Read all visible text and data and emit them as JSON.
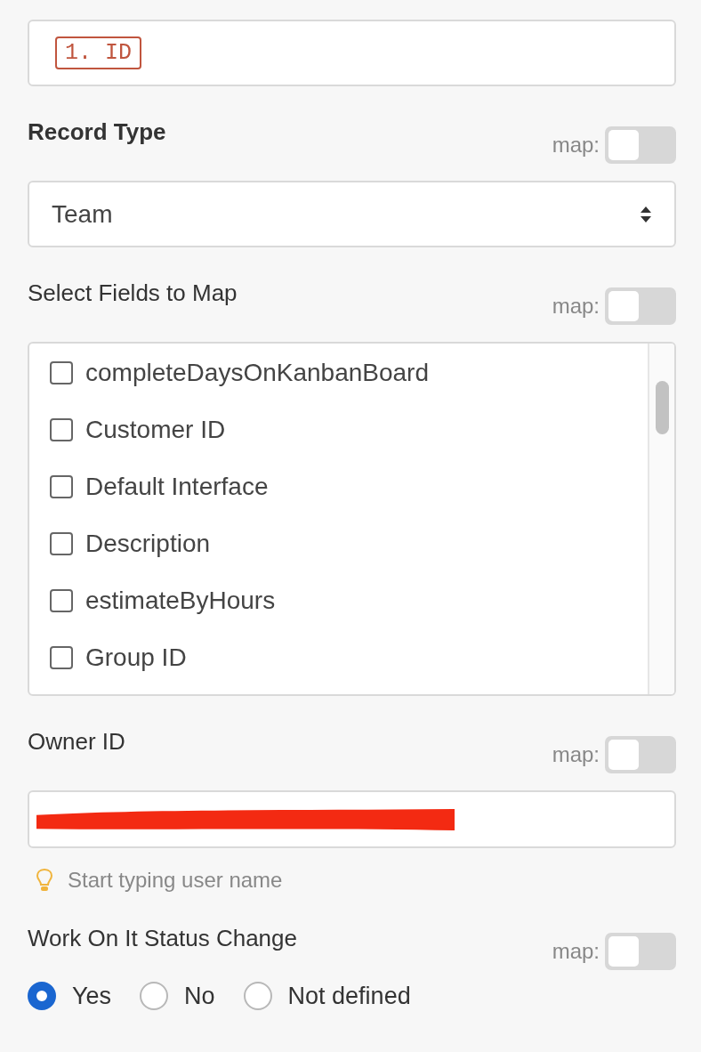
{
  "id_field": {
    "token": "1. ID"
  },
  "record_type": {
    "label": "Record Type",
    "map_label": "map:",
    "map_on": false,
    "value": "Team"
  },
  "fields_to_map": {
    "label": "Select Fields to Map",
    "map_label": "map:",
    "map_on": false,
    "options": [
      {
        "label": "completeDaysOnKanbanBoard",
        "checked": false
      },
      {
        "label": "Customer ID",
        "checked": false
      },
      {
        "label": "Default Interface",
        "checked": false
      },
      {
        "label": "Description",
        "checked": false
      },
      {
        "label": "estimateByHours",
        "checked": false
      },
      {
        "label": "Group ID",
        "checked": false
      }
    ]
  },
  "owner_id": {
    "label": "Owner ID",
    "map_label": "map:",
    "map_on": false,
    "redacted": true,
    "hint": "Start typing user name"
  },
  "status_change": {
    "label": "Work On It Status Change",
    "map_label": "map:",
    "map_on": false,
    "options": [
      {
        "label": "Yes",
        "selected": true
      },
      {
        "label": "No",
        "selected": false
      },
      {
        "label": "Not defined",
        "selected": false
      }
    ]
  }
}
